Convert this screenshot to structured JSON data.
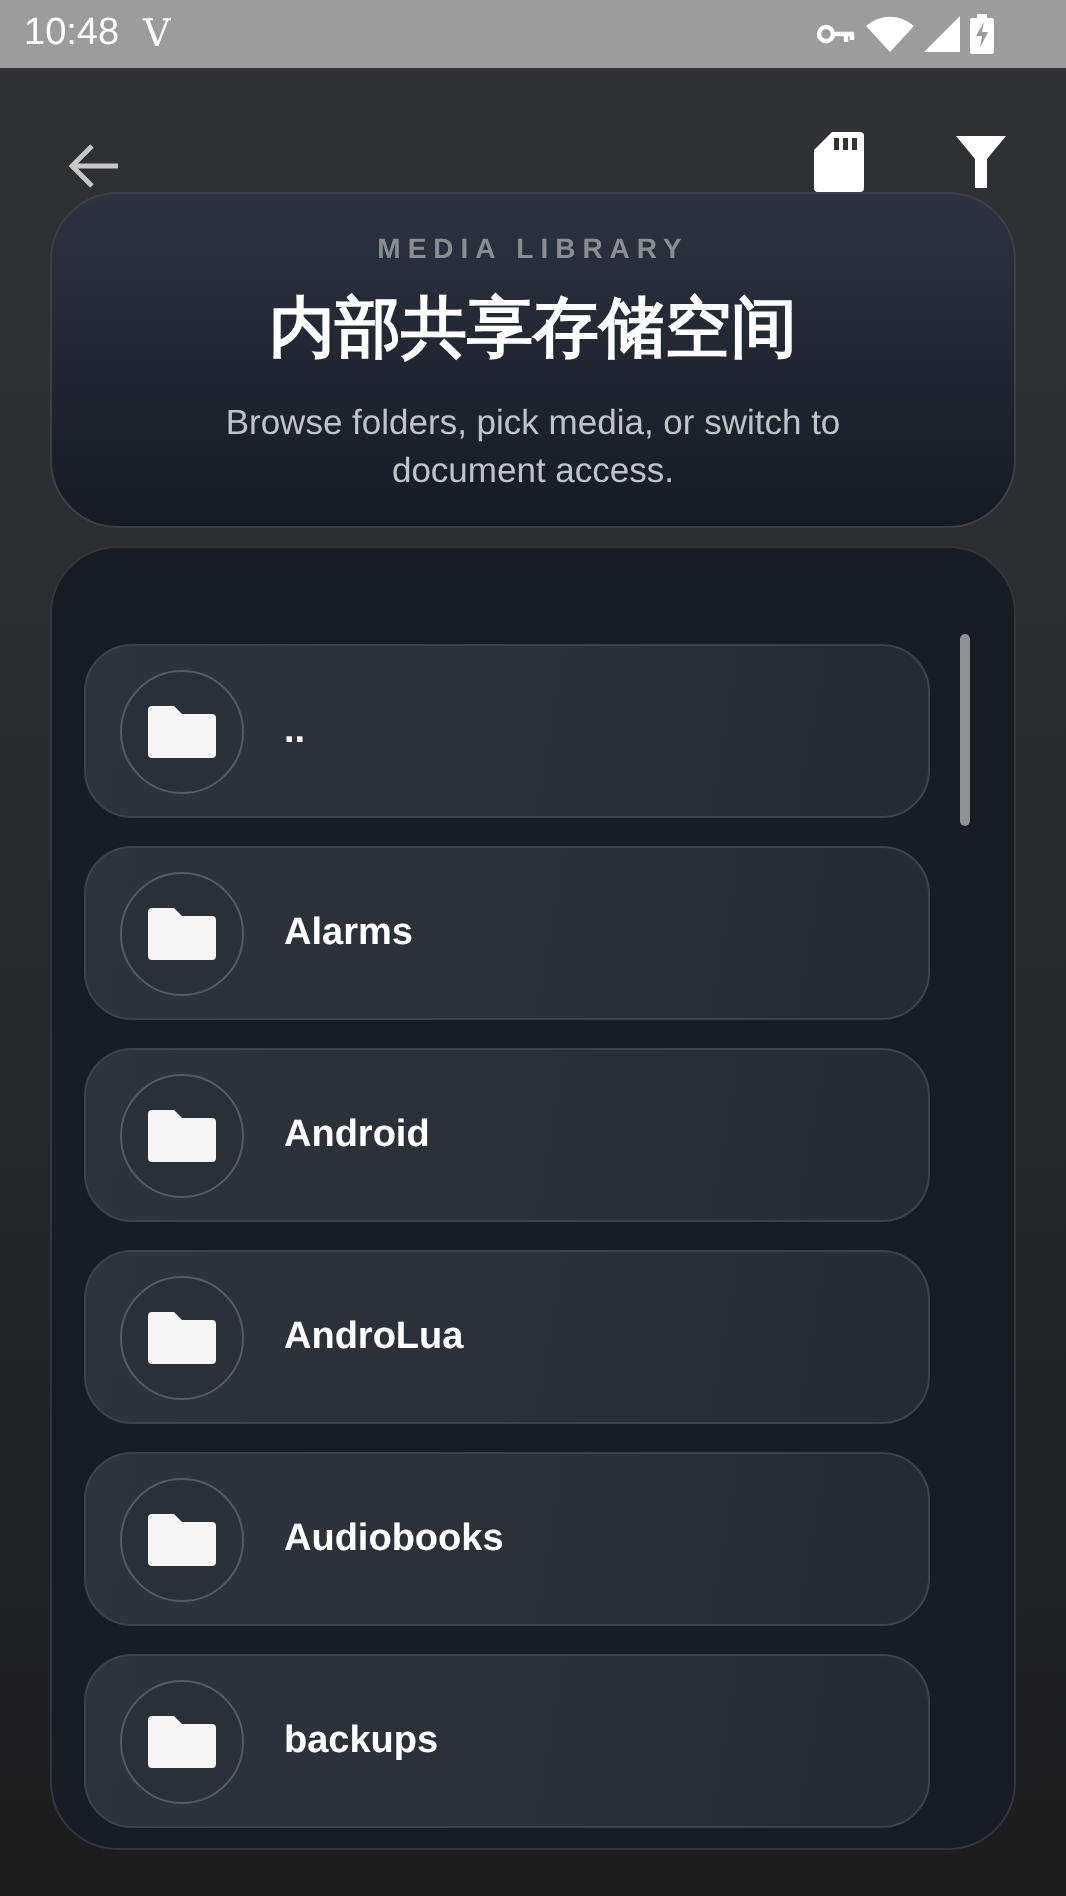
{
  "status_bar": {
    "time": "10:48",
    "carrier": "V"
  },
  "header": {
    "eyebrow": "MEDIA LIBRARY",
    "title": "内部共享存储空间",
    "subtitle": "Browse folders, pick media, or switch to document access."
  },
  "folders": [
    {
      "name": ".."
    },
    {
      "name": "Alarms"
    },
    {
      "name": "Android"
    },
    {
      "name": "AndroLua"
    },
    {
      "name": "Audiobooks"
    },
    {
      "name": "backups"
    }
  ]
}
